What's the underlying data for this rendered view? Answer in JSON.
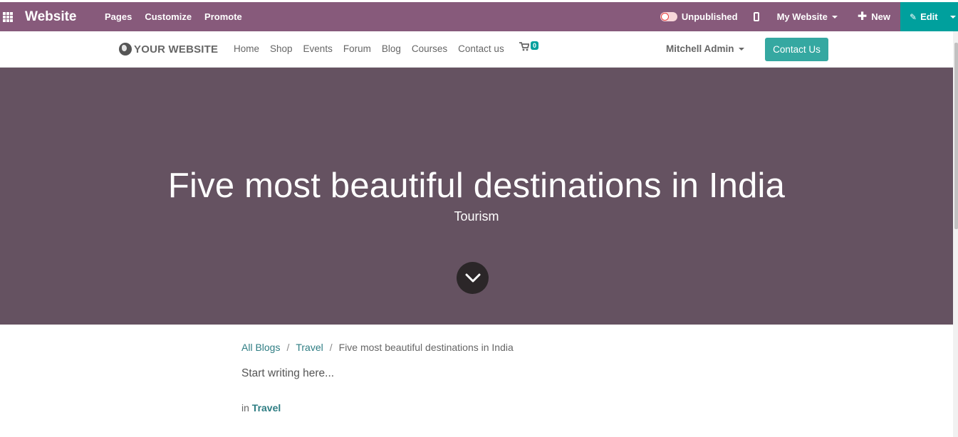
{
  "admin": {
    "app_name": "Website",
    "menu": [
      "Pages",
      "Customize",
      "Promote"
    ],
    "publish_status": "Unpublished",
    "website_selector": "My Website",
    "new_label": "New",
    "edit_label": "Edit",
    "colors": {
      "bar": "#875a7b",
      "edit": "#00a09d"
    }
  },
  "navbar": {
    "logo_text": "YOUR WEBSITE",
    "links": [
      "Home",
      "Shop",
      "Events",
      "Forum",
      "Blog",
      "Courses",
      "Contact us"
    ],
    "cart_count": "0",
    "user": "Mitchell Admin",
    "cta": "Contact Us"
  },
  "hero": {
    "title": "Five most beautiful destinations in India",
    "subtitle": "Tourism",
    "background": "#655261"
  },
  "breadcrumb": {
    "items": [
      "All Blogs",
      "Travel",
      "Five most beautiful destinations in India"
    ],
    "separator": "/"
  },
  "content": {
    "placeholder": "Start writing here...",
    "in_label": "in",
    "category": "Travel"
  }
}
